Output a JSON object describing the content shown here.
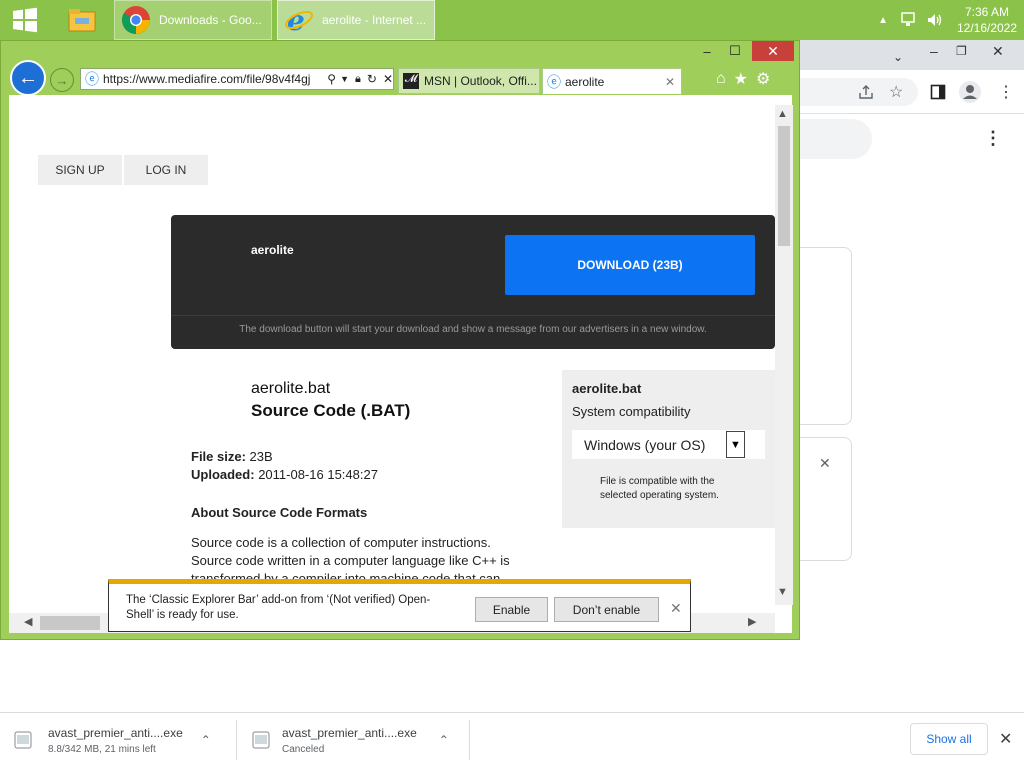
{
  "taskbar": {
    "chrome_label": "Downloads - Goo...",
    "ie_label": "aerolite - Internet ...",
    "time": "7:36 AM",
    "date": "12/16/2022"
  },
  "ie": {
    "address": "https://www.mediafire.com/file/98v4f4gj",
    "tabs": [
      {
        "label": "MSN | Outlook, Offi..."
      },
      {
        "label": "aerolite"
      }
    ]
  },
  "page": {
    "nav": {
      "signup": "SIGN UP",
      "login": "LOG IN"
    },
    "download": {
      "name": "aerolite",
      "button": "DOWNLOAD (23B)",
      "note": "The download button will start your download and show a message from our advertisers in a new window."
    },
    "file": {
      "name": "aerolite.bat",
      "type": "Source Code (.BAT)",
      "size_label": "File size:",
      "size": "23B",
      "uploaded_label": "Uploaded:",
      "uploaded": "2011-08-16 15:48:27"
    },
    "about": {
      "heading": "About Source Code Formats",
      "text": "Source code is a collection of computer instructions. Source code written in a computer language like C++ is transformed by a compiler into machine code that can"
    },
    "sidebar": {
      "name": "aerolite.bat",
      "compat": "System compatibility",
      "os": "Windows (your OS)",
      "note": "File is compatible with the selected operating system."
    }
  },
  "notification": {
    "text": "The ‘Classic Explorer Bar’ add-on from ‘(Not verified) Open-Shell’ is ready for use.",
    "enable": "Enable",
    "dont_enable": "Don’t enable"
  },
  "downloads": [
    {
      "name": "avast_premier_anti....exe",
      "status": "8.8/342 MB, 21 mins left"
    },
    {
      "name": "avast_premier_anti....exe",
      "status": "Canceled"
    }
  ],
  "shelf": {
    "show_all": "Show all"
  }
}
